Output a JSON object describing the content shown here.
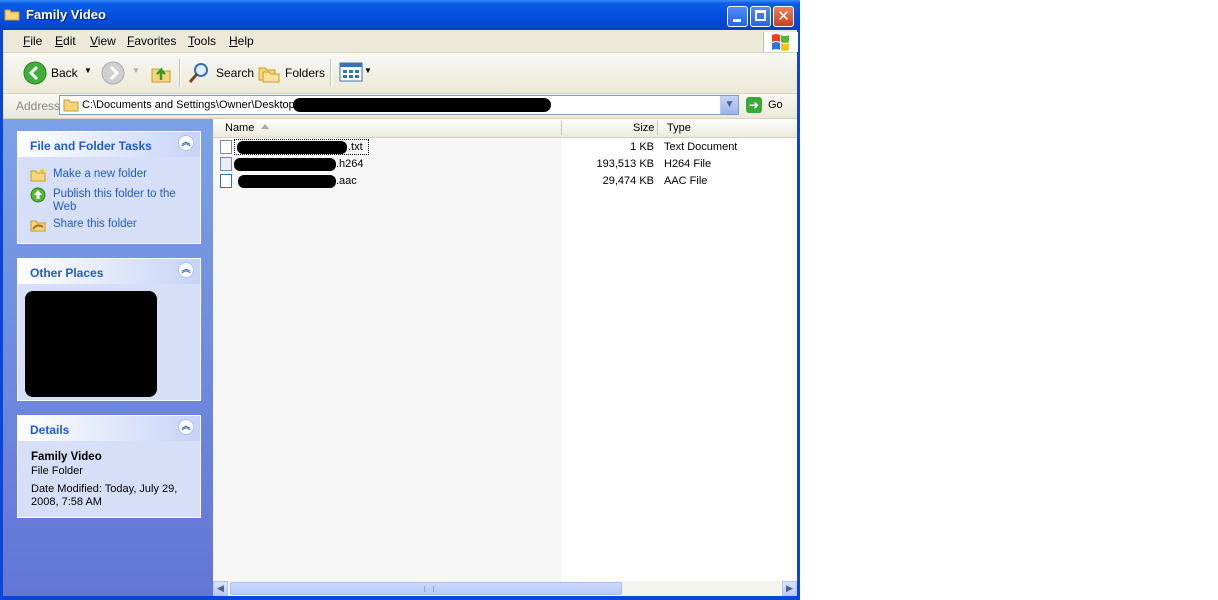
{
  "window": {
    "title": "Family Video",
    "controls": [
      "minimize",
      "maximize",
      "close"
    ],
    "colors": {
      "titlebar": "#0450e0",
      "taskpane": "#6375d6",
      "link": "#215dc6"
    }
  },
  "menu": {
    "items": [
      {
        "label": "File",
        "key": "F",
        "rest": "ile"
      },
      {
        "label": "Edit",
        "key": "E",
        "rest": "dit"
      },
      {
        "label": "View",
        "key": "V",
        "rest": "iew"
      },
      {
        "label": "Favorites",
        "key": "F",
        "rest": "avorites"
      },
      {
        "label": "Tools",
        "key": "T",
        "rest": "ools"
      },
      {
        "label": "Help",
        "key": "H",
        "rest": "elp"
      }
    ]
  },
  "toolbar": {
    "back_label": "Back",
    "search_label": "Search",
    "folders_label": "Folders"
  },
  "address": {
    "label": "Address",
    "value": "C:\\Documents and Settings\\Owner\\Desktop\\",
    "go_label": "Go"
  },
  "tasks": {
    "title": "File and Folder Tasks",
    "items": [
      "Make a new folder",
      "Publish this folder to the",
      "Web",
      "Share this folder"
    ]
  },
  "other_places": {
    "title": "Other Places"
  },
  "details": {
    "title": "Details",
    "name": "Family Video",
    "type": "File Folder",
    "date_line1": "Date Modified: Today, July 29,",
    "date_line2": "2008, 7:58 AM"
  },
  "columns": {
    "name": "Name",
    "size": "Size",
    "type": "Type"
  },
  "files": [
    {
      "ext": ".txt",
      "size": "1 KB",
      "type": "Text Document"
    },
    {
      "ext": ".h264",
      "size": "193,513 KB",
      "type": "H264 File"
    },
    {
      "ext": ".aac",
      "size": "29,474 KB",
      "type": "AAC File"
    }
  ]
}
